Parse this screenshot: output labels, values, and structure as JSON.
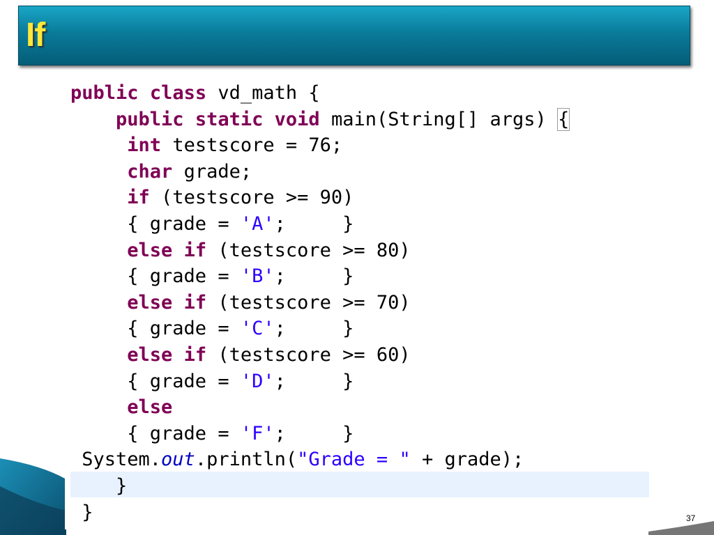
{
  "slide": {
    "title": "If",
    "page_number": "37"
  },
  "code": {
    "lines": [
      [
        {
          "t": "public",
          "c": "kw"
        },
        {
          "t": " "
        },
        {
          "t": "class",
          "c": "kw"
        },
        {
          "t": " vd_math {"
        }
      ],
      [
        {
          "t": "    "
        },
        {
          "t": "public",
          "c": "kw"
        },
        {
          "t": " "
        },
        {
          "t": "static",
          "c": "kw"
        },
        {
          "t": " "
        },
        {
          "t": "void",
          "c": "kw"
        },
        {
          "t": " main(String[] args) "
        },
        {
          "t": "{",
          "c": "brace-box"
        }
      ],
      [
        {
          "t": "     "
        },
        {
          "t": "int",
          "c": "kw"
        },
        {
          "t": " testscore = 76;"
        }
      ],
      [
        {
          "t": "     "
        },
        {
          "t": "char",
          "c": "kw"
        },
        {
          "t": " grade;"
        }
      ],
      [
        {
          "t": "     "
        },
        {
          "t": "if",
          "c": "kw"
        },
        {
          "t": " (testscore >= 90)"
        }
      ],
      [
        {
          "t": "     { grade = "
        },
        {
          "t": "'A'",
          "c": "str"
        },
        {
          "t": ";     }"
        }
      ],
      [
        {
          "t": "     "
        },
        {
          "t": "else",
          "c": "kw"
        },
        {
          "t": " "
        },
        {
          "t": "if",
          "c": "kw"
        },
        {
          "t": " (testscore >= 80)"
        }
      ],
      [
        {
          "t": "     { grade = "
        },
        {
          "t": "'B'",
          "c": "str"
        },
        {
          "t": ";     }"
        }
      ],
      [
        {
          "t": "     "
        },
        {
          "t": "else",
          "c": "kw"
        },
        {
          "t": " "
        },
        {
          "t": "if",
          "c": "kw"
        },
        {
          "t": " (testscore >= 70)"
        }
      ],
      [
        {
          "t": "     { grade = "
        },
        {
          "t": "'C'",
          "c": "str"
        },
        {
          "t": ";     }"
        }
      ],
      [
        {
          "t": "     "
        },
        {
          "t": "else",
          "c": "kw"
        },
        {
          "t": " "
        },
        {
          "t": "if",
          "c": "kw"
        },
        {
          "t": " (testscore >= 60)"
        }
      ],
      [
        {
          "t": "     { grade = "
        },
        {
          "t": "'D'",
          "c": "str"
        },
        {
          "t": ";     }"
        }
      ],
      [
        {
          "t": "     "
        },
        {
          "t": "else",
          "c": "kw"
        }
      ],
      [
        {
          "t": "     { grade = "
        },
        {
          "t": "'F'",
          "c": "str"
        },
        {
          "t": ";     }"
        }
      ],
      [
        {
          "t": " System."
        },
        {
          "t": "out",
          "c": "field"
        },
        {
          "t": ".println("
        },
        {
          "t": "\"Grade = \"",
          "c": "str"
        },
        {
          "t": " + grade);"
        }
      ],
      [
        {
          "t": "    }"
        }
      ],
      [
        {
          "t": " }"
        }
      ]
    ]
  }
}
